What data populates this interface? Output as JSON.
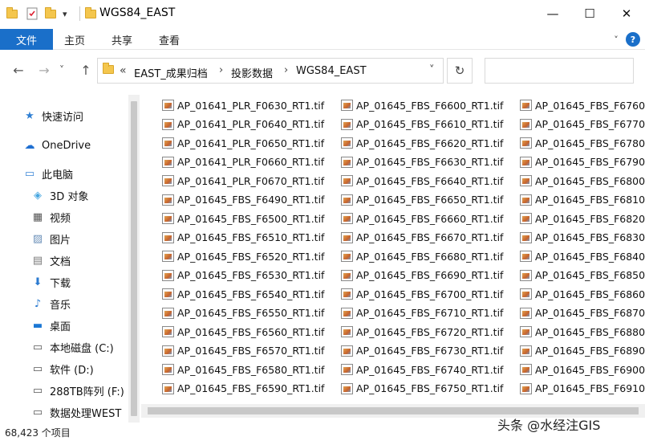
{
  "window": {
    "title": "WGS84_EAST",
    "minimize_glyph": "—",
    "maximize_glyph": "☐",
    "close_glyph": "✕",
    "qa_dropdown_glyph": "▾"
  },
  "ribbon": {
    "file_label": "文件",
    "tabs": [
      "主页",
      "共享",
      "查看"
    ],
    "collapse_glyph": "˅",
    "help_glyph": "?"
  },
  "navbar": {
    "back_glyph": "←",
    "forward_glyph": "→",
    "recent_glyph": "˅",
    "up_glyph": "↑",
    "overflow_glyph": "«",
    "path": [
      "EAST_成果归档",
      "投影数据",
      "WGS84_EAST"
    ],
    "sep_glyph": "›",
    "dropdown_glyph": "˅",
    "refresh_glyph": "↻",
    "search_placeholder": ""
  },
  "nav_pane": {
    "items": [
      {
        "label": "快速访问",
        "icon": "star-icon",
        "glyph": "★",
        "color": "#2f7fd3"
      },
      {
        "label": "OneDrive",
        "icon": "cloud-icon",
        "glyph": "☁",
        "color": "#1f6fd1"
      },
      {
        "label": "此电脑",
        "icon": "computer-icon",
        "glyph": "▭",
        "color": "#3a86d6"
      },
      {
        "label": "3D 对象",
        "icon": "cube-icon",
        "glyph": "◈",
        "color": "#47a6e0"
      },
      {
        "label": "视频",
        "icon": "film-icon",
        "glyph": "▦",
        "color": "#555555"
      },
      {
        "label": "图片",
        "icon": "picture-icon",
        "glyph": "▨",
        "color": "#6a8fb8"
      },
      {
        "label": "文档",
        "icon": "document-icon",
        "glyph": "▤",
        "color": "#7a7a7a"
      },
      {
        "label": "下载",
        "icon": "download-icon",
        "glyph": "⬇",
        "color": "#2a7ad0"
      },
      {
        "label": "音乐",
        "icon": "music-icon",
        "glyph": "♪",
        "color": "#2a7ad0"
      },
      {
        "label": "桌面",
        "icon": "desktop-icon",
        "glyph": "▬",
        "color": "#1c78d4"
      },
      {
        "label": "本地磁盘 (C:)",
        "icon": "drive-c-icon",
        "glyph": "▭",
        "color": "#555555"
      },
      {
        "label": "软件 (D:)",
        "icon": "drive-d-icon",
        "glyph": "▭",
        "color": "#555555"
      },
      {
        "label": "288TB阵列 (F:)",
        "icon": "drive-f-icon",
        "glyph": "▭",
        "color": "#555555"
      },
      {
        "label": "数据处理WEST",
        "icon": "network-drive-icon",
        "glyph": "▭",
        "color": "#555555"
      }
    ]
  },
  "files": {
    "columns": [
      [
        "AP_01641_PLR_F0630_RT1.tif",
        "AP_01641_PLR_F0640_RT1.tif",
        "AP_01641_PLR_F0650_RT1.tif",
        "AP_01641_PLR_F0660_RT1.tif",
        "AP_01641_PLR_F0670_RT1.tif",
        "AP_01645_FBS_F6490_RT1.tif",
        "AP_01645_FBS_F6500_RT1.tif",
        "AP_01645_FBS_F6510_RT1.tif",
        "AP_01645_FBS_F6520_RT1.tif",
        "AP_01645_FBS_F6530_RT1.tif",
        "AP_01645_FBS_F6540_RT1.tif",
        "AP_01645_FBS_F6550_RT1.tif",
        "AP_01645_FBS_F6560_RT1.tif",
        "AP_01645_FBS_F6570_RT1.tif",
        "AP_01645_FBS_F6580_RT1.tif",
        "AP_01645_FBS_F6590_RT1.tif"
      ],
      [
        "AP_01645_FBS_F6600_RT1.tif",
        "AP_01645_FBS_F6610_RT1.tif",
        "AP_01645_FBS_F6620_RT1.tif",
        "AP_01645_FBS_F6630_RT1.tif",
        "AP_01645_FBS_F6640_RT1.tif",
        "AP_01645_FBS_F6650_RT1.tif",
        "AP_01645_FBS_F6660_RT1.tif",
        "AP_01645_FBS_F6670_RT1.tif",
        "AP_01645_FBS_F6680_RT1.tif",
        "AP_01645_FBS_F6690_RT1.tif",
        "AP_01645_FBS_F6700_RT1.tif",
        "AP_01645_FBS_F6710_RT1.tif",
        "AP_01645_FBS_F6720_RT1.tif",
        "AP_01645_FBS_F6730_RT1.tif",
        "AP_01645_FBS_F6740_RT1.tif",
        "AP_01645_FBS_F6750_RT1.tif"
      ],
      [
        "AP_01645_FBS_F6760",
        "AP_01645_FBS_F6770",
        "AP_01645_FBS_F6780",
        "AP_01645_FBS_F6790",
        "AP_01645_FBS_F6800",
        "AP_01645_FBS_F6810",
        "AP_01645_FBS_F6820",
        "AP_01645_FBS_F6830",
        "AP_01645_FBS_F6840",
        "AP_01645_FBS_F6850",
        "AP_01645_FBS_F6860",
        "AP_01645_FBS_F6870",
        "AP_01645_FBS_F6880",
        "AP_01645_FBS_F6890",
        "AP_01645_FBS_F6900",
        "AP_01645_FBS_F6910"
      ]
    ]
  },
  "status": {
    "item_count": "68,423 个项目"
  },
  "watermark": "头条 @水经注GIS",
  "colors": {
    "accent": "#1a6fc9",
    "folder": "#f4c64d"
  }
}
